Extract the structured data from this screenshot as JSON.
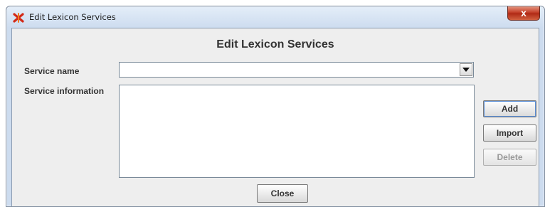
{
  "window": {
    "title": "Edit Lexicon Services",
    "close_glyph": "x"
  },
  "dialog": {
    "heading": "Edit Lexicon Services",
    "service_name_label": "Service name",
    "service_name_value": "",
    "service_info_label": "Service information",
    "service_info_value": ""
  },
  "buttons": {
    "add": "Add",
    "import": "Import",
    "delete": "Delete",
    "close": "Close"
  },
  "icons": {
    "app": "lexicon-app-icon",
    "dropdown": "chevron-down-icon"
  },
  "colors": {
    "accent_close": "#c7452e",
    "client_bg": "#eeeeee"
  }
}
